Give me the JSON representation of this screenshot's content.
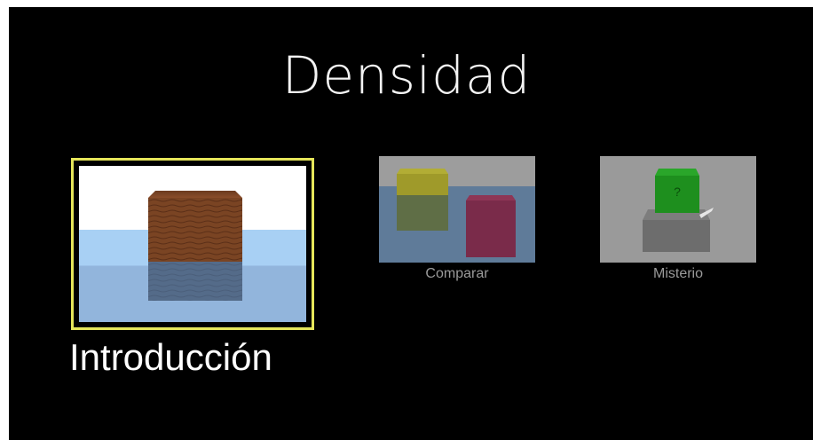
{
  "title": "Densidad",
  "screens": [
    {
      "id": "intro",
      "label": "Introducción",
      "selected": true
    },
    {
      "id": "comparar",
      "label": "Comparar",
      "selected": false
    },
    {
      "id": "misterio",
      "label": "Misterio",
      "selected": false
    }
  ],
  "misterio_block_mark": "?",
  "colors": {
    "background": "#000000",
    "selection_border": "#e6e65a",
    "title_text": "#f4f4f4",
    "unselected_label": "#9a9a9a"
  }
}
